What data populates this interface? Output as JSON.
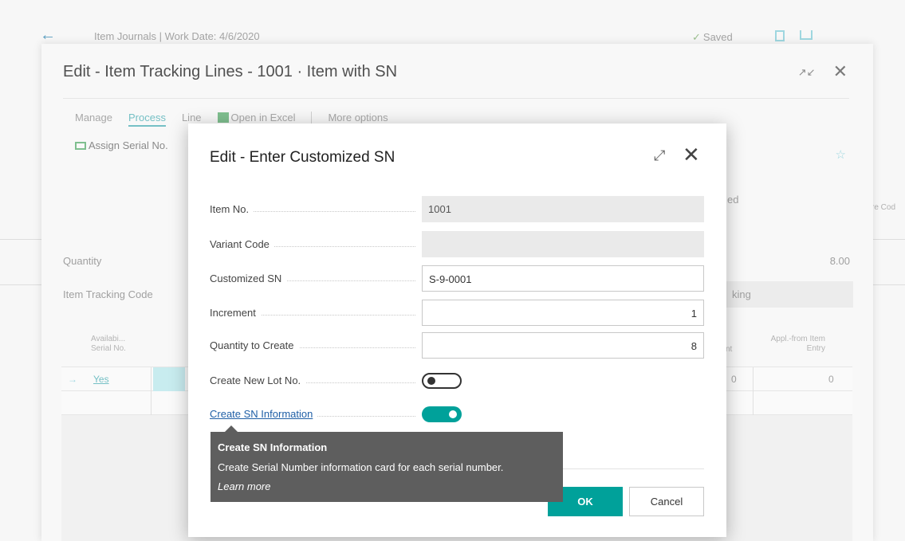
{
  "background": {
    "back_icon": "back-arrow-icon",
    "page_title": "Item Journals | Work Date: 4/6/2020",
    "saved_label": "Saved",
    "right_strip_text": "re Cod"
  },
  "item_tracking_lines": {
    "title": "Edit - Item Tracking Lines - 1001 · Item with SN",
    "menu": [
      "Manage",
      "Process",
      "Line",
      "Open in Excel",
      "More options"
    ],
    "action_assign": "Assign Serial No.",
    "partial_label_ed": "ed",
    "quantity_label": "Quantity",
    "quantity_value": "8.00",
    "item_tracking_code_label": "Item Tracking Code",
    "item_tracking_code_partial": "king",
    "col_availability": [
      "Availabi...",
      "Serial No."
    ],
    "col_partial": "nt",
    "col_appl_from": [
      "Appl.-from Item",
      "Entry"
    ],
    "row_value": "Yes",
    "row_zero_1": "0",
    "row_zero_2": "0"
  },
  "dialog": {
    "title": "Edit - Enter Customized SN",
    "fields": {
      "item_no": {
        "label": "Item No.",
        "value": "1001"
      },
      "variant_code": {
        "label": "Variant Code",
        "value": ""
      },
      "customized_sn": {
        "label": "Customized SN",
        "value": "S-9-0001"
      },
      "increment": {
        "label": "Increment",
        "value": "1"
      },
      "quantity_to_create": {
        "label": "Quantity to Create",
        "value": "8"
      },
      "create_new_lot_no": {
        "label": "Create New Lot No.",
        "state": "off"
      },
      "create_sn_information": {
        "label": "Create SN Information",
        "state": "on"
      }
    },
    "ok_label": "OK",
    "cancel_label": "Cancel"
  },
  "tooltip": {
    "title": "Create SN Information",
    "description": "Create Serial Number information card for each serial number.",
    "learn_more": "Learn more"
  },
  "colors": {
    "accent": "#00a19a",
    "link": "#1f5fa6",
    "tooltip_bg": "#5e5e5e"
  }
}
